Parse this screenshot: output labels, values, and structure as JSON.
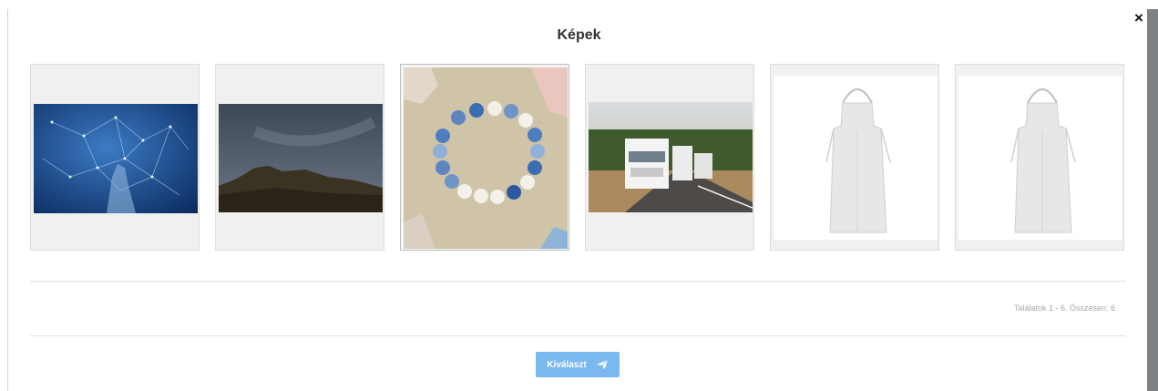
{
  "dialog": {
    "title": "Képek",
    "close_label": "×",
    "results_text": "Találatok 1 - 6. Összesen: 6",
    "select_label": "Kiválaszt",
    "accent_color": "#7ab8ef"
  },
  "images": [
    {
      "subject": "network-hand"
    },
    {
      "subject": "night-sky-hill"
    },
    {
      "subject": "bead-bracelet-sand",
      "selected": true
    },
    {
      "subject": "trucks-road"
    },
    {
      "subject": "white-apron"
    },
    {
      "subject": "white-apron"
    }
  ],
  "icons": {
    "close": "close-icon",
    "send": "paper-plane-icon"
  }
}
